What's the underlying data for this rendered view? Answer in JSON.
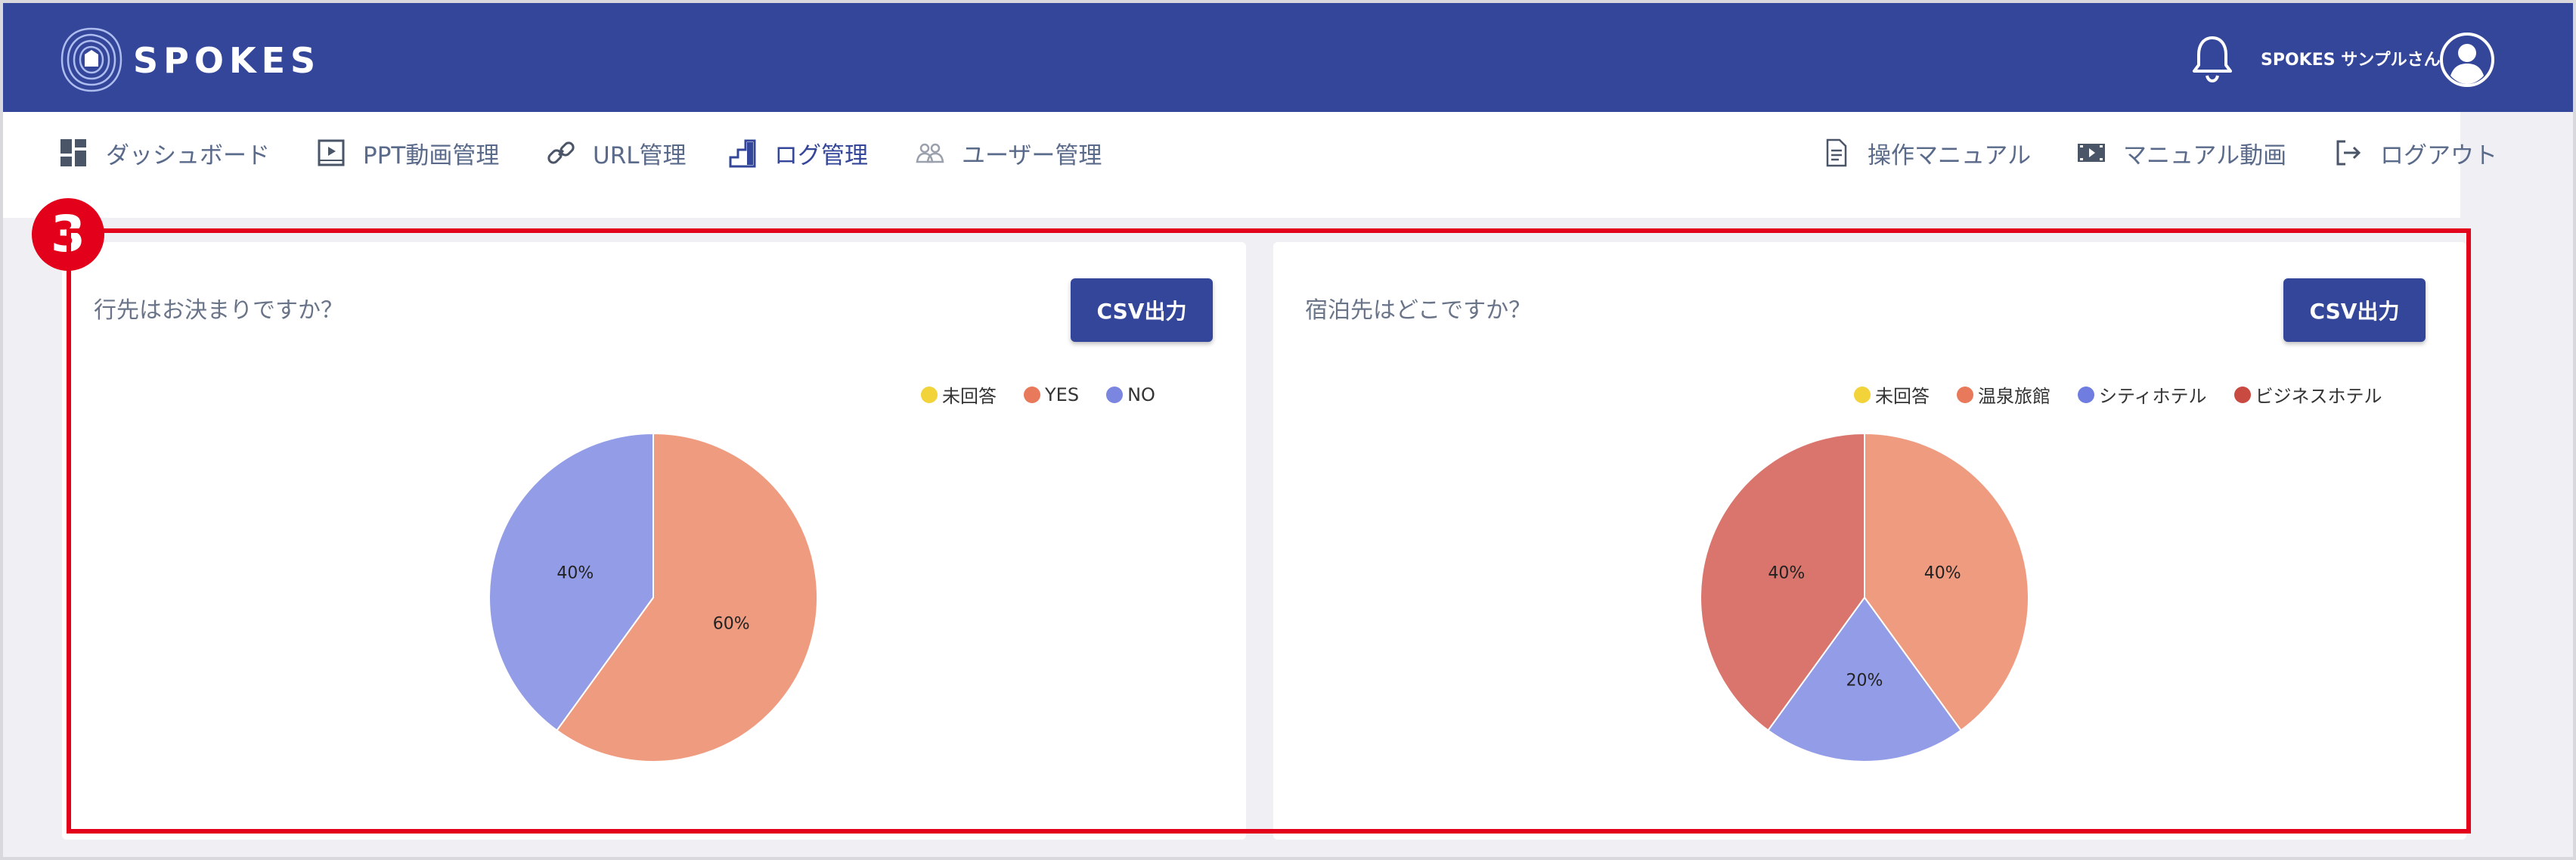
{
  "header": {
    "brand": "SPOKES",
    "user_name": "SPOKES サンプルさん",
    "bg_color": "#344699"
  },
  "nav": {
    "left": [
      {
        "label": "ダッシュボード",
        "icon": "dashboard-icon"
      },
      {
        "label": "PPT動画管理",
        "icon": "film-frame-icon"
      },
      {
        "label": "URL管理",
        "icon": "link-icon"
      },
      {
        "label": "ログ管理",
        "icon": "stairs-icon",
        "active": true
      },
      {
        "label": "ユーザー管理",
        "icon": "users-icon"
      }
    ],
    "right": [
      {
        "label": "操作マニュアル",
        "icon": "document-icon"
      },
      {
        "label": "マニュアル動画",
        "icon": "film-strip-icon"
      },
      {
        "label": "ログアウト",
        "icon": "logout-icon"
      }
    ]
  },
  "badge": "3",
  "panels": [
    {
      "title": "行先はお決まりですか？",
      "csv_label": "CSV出力",
      "chart_data": {
        "type": "pie",
        "categories": [
          "未回答",
          "YES",
          "NO"
        ],
        "values": [
          0,
          60,
          40
        ],
        "labels": [
          "",
          "60%",
          "40%"
        ],
        "legend_colors": [
          "#f2d33a",
          "#e8795a",
          "#7b86e0"
        ],
        "slice_colors": [
          "#f2d33a",
          "#ef9b80",
          "#939ce6"
        ],
        "legend": "top-right"
      }
    },
    {
      "title": "宿泊先はどこですか？",
      "csv_label": "CSV出力",
      "chart_data": {
        "type": "pie",
        "categories": [
          "未回答",
          "温泉旅館",
          "シティホテル",
          "ビジネスホテル"
        ],
        "values": [
          0,
          40,
          20,
          40
        ],
        "labels": [
          "",
          "40%",
          "20%",
          "40%"
        ],
        "legend_colors": [
          "#f2d33a",
          "#e8795a",
          "#6f7ce0",
          "#c94a40"
        ],
        "slice_colors": [
          "#f2d33a",
          "#ef9b80",
          "#939ce6",
          "#d9756c"
        ],
        "legend": "top-right"
      }
    }
  ]
}
